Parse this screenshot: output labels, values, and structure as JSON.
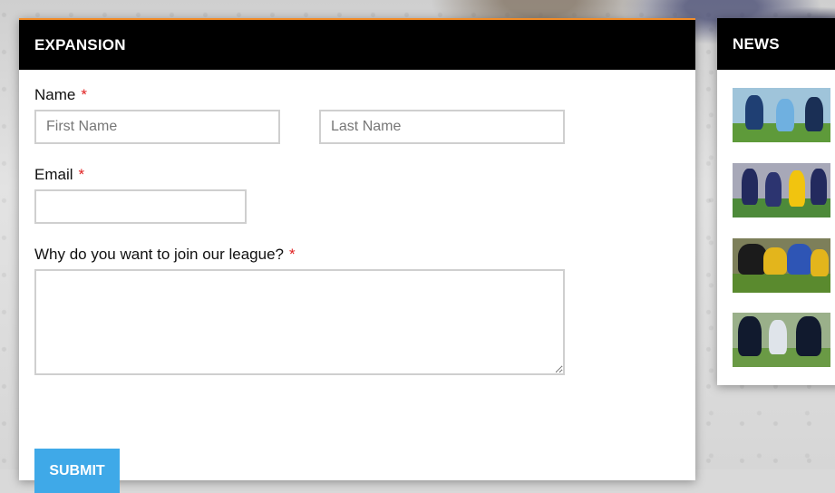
{
  "expansion": {
    "title": "EXPANSION",
    "name_label": "Name",
    "required_mark": "*",
    "first_name_placeholder": "First Name",
    "last_name_placeholder": "Last Name",
    "email_label": "Email",
    "email_value": "",
    "why_label": "Why do you want to join our league?",
    "why_value": "",
    "submit_label": "SUBMIT"
  },
  "news": {
    "title": "NEWS",
    "items": [
      {
        "image": "rugby-photo-1"
      },
      {
        "image": "rugby-photo-2"
      },
      {
        "image": "rugby-photo-3"
      },
      {
        "image": "rugby-photo-4"
      }
    ]
  },
  "colors": {
    "header_bg": "#000000",
    "accent_orange": "#f28c28",
    "button_blue": "#3fa9e8",
    "required_red": "#e02020"
  }
}
